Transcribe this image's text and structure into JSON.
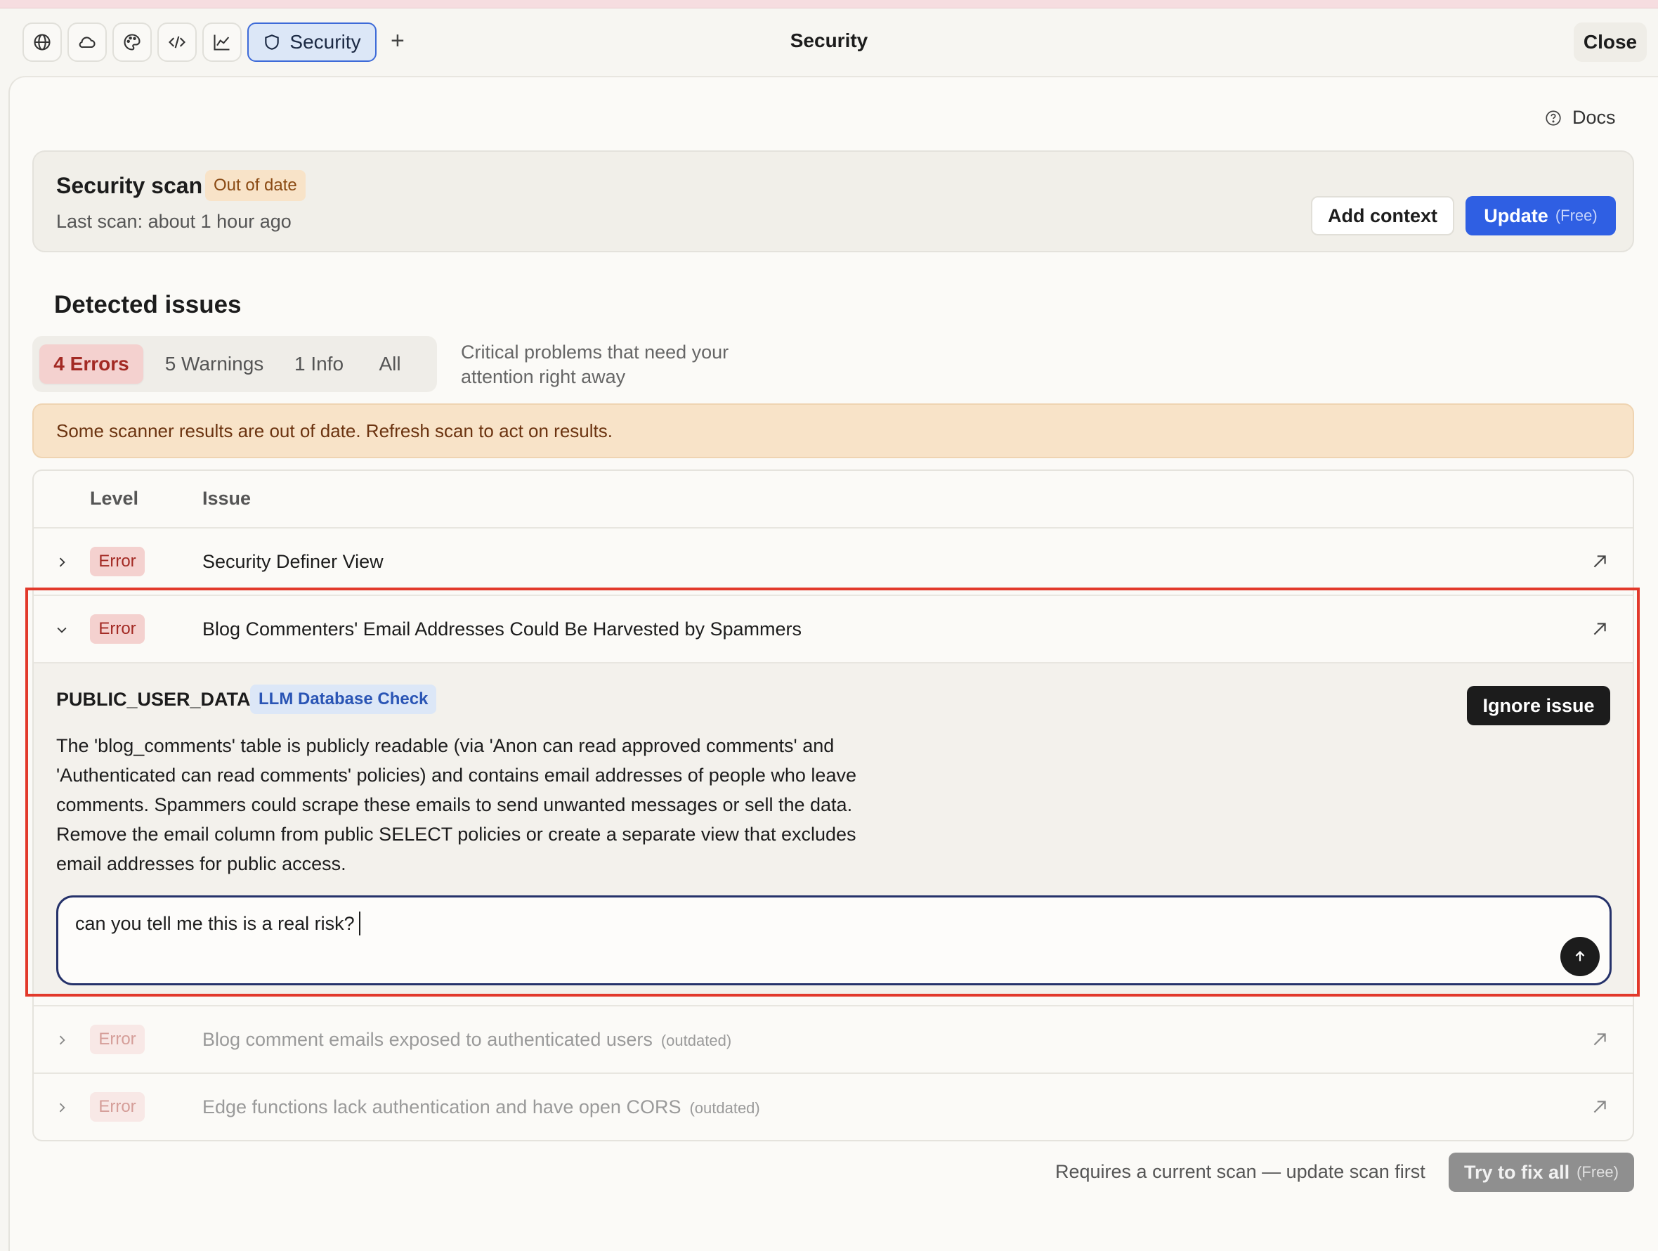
{
  "toolbar": {
    "icons": [
      "globe-icon",
      "cloud-icon",
      "palette-icon",
      "code-icon",
      "chart-icon"
    ],
    "active_tab_label": "Security",
    "plus": "+",
    "title": "Security",
    "close_label": "Close"
  },
  "docs_label": "Docs",
  "scan": {
    "title": "Security scan",
    "status_badge": "Out of date",
    "last_scan": "Last scan: about 1 hour ago",
    "add_context_label": "Add context",
    "update_label": "Update",
    "update_price": "(Free)"
  },
  "detected_title": "Detected issues",
  "filter_tabs": [
    {
      "label": "4 Errors",
      "active": true
    },
    {
      "label": "5 Warnings",
      "active": false
    },
    {
      "label": "1 Info",
      "active": false
    },
    {
      "label": "All",
      "active": false
    }
  ],
  "filter_description": "Critical problems that need your attention right away",
  "alert_text": "Some scanner results are out of date. Refresh scan to act on results.",
  "table": {
    "headers": {
      "level": "Level",
      "issue": "Issue"
    },
    "rows": [
      {
        "level": "Error",
        "issue": "Security Definer View",
        "expanded": false,
        "outdated": false,
        "outdated_label": ""
      },
      {
        "level": "Error",
        "issue": "Blog Commenters' Email Addresses Could Be Harvested by Spammers",
        "expanded": true,
        "outdated": false,
        "outdated_label": ""
      },
      {
        "level": "Error",
        "issue": "Blog comment emails exposed to authenticated users",
        "expanded": false,
        "outdated": true,
        "outdated_label": "(outdated)"
      },
      {
        "level": "Error",
        "issue": "Edge functions lack authentication and have open CORS",
        "expanded": false,
        "outdated": true,
        "outdated_label": "(outdated)"
      }
    ],
    "expanded_detail": {
      "code": "PUBLIC_USER_DATA",
      "check_badge": "LLM Database Check",
      "ignore_label": "Ignore issue",
      "description": "The 'blog_comments' table is publicly readable (via 'Anon can read approved comments' and 'Authenticated can read comments' policies) and contains email addresses of people who leave comments. Spammers could scrape these emails to send unwanted messages or sell the data. Remove the email column from public SELECT policies or create a separate view that excludes email addresses for public access.",
      "chat_input_value": "can you tell me this is a real risk?"
    }
  },
  "footer": {
    "note": "Requires a current scan — update scan first",
    "fix_all_label": "Try to fix all",
    "fix_all_price": "(Free)"
  },
  "colors": {
    "accent": "#2f5fe3",
    "error_badge_bg": "#f4d1cf",
    "error_text": "#a32a24",
    "warning_bg": "#f8e3c8",
    "highlight_border": "#e2392b"
  }
}
